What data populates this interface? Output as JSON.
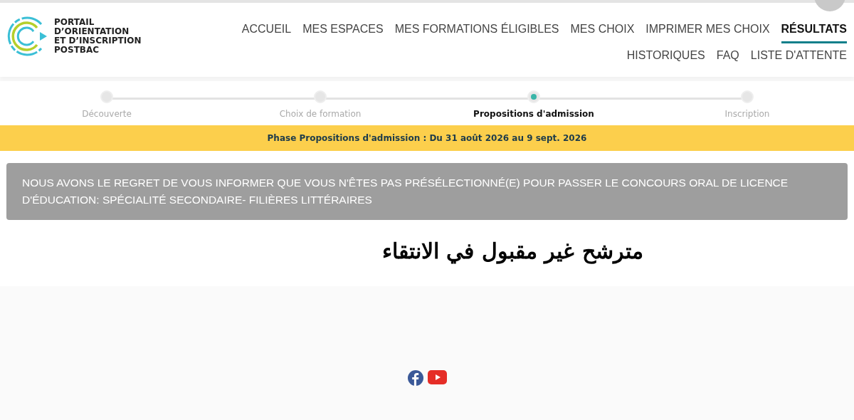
{
  "logo": {
    "lines": [
      "PORTAIL",
      "D’ORIENTATION",
      "ET D’INSCRIPTION",
      "POSTBAC"
    ]
  },
  "nav": [
    {
      "label": "ACCUEIL",
      "selected": false
    },
    {
      "label": "MES ESPACES",
      "selected": false
    },
    {
      "label": "MES FORMATIONS ÉLIGIBLES",
      "selected": false
    },
    {
      "label": "MES CHOIX",
      "selected": false
    },
    {
      "label": "IMPRIMER MES CHOIX",
      "selected": false
    },
    {
      "label": "RÉSULTATS",
      "selected": true
    },
    {
      "label": "HISTORIQUES",
      "selected": false
    },
    {
      "label": "FAQ",
      "selected": false
    },
    {
      "label": "LISTE D'ATTENTE",
      "selected": false
    }
  ],
  "steps": [
    {
      "label": "Découverte",
      "selected": false
    },
    {
      "label": "Choix de formation",
      "selected": false
    },
    {
      "label": "Propositions d'admission",
      "selected": true
    },
    {
      "label": "Inscription",
      "selected": false
    }
  ],
  "phase_banner": "Phase Propositions d'admission : Du 31 août 2026 au 9 sept. 2026",
  "alert": "NOUS AVONS LE REGRET DE VOUS INFORMER QUE VOUS N'ÊTES PAS PRÉSÉLECTIONNÉ(E) POUR PASSER LE CONCOURS ORAL DE LICENCE D'ÉDUCATION: SPÉCIALITÉ SECONDAIRE- FILIÈRES LITTÉRAIRES",
  "result_note": "مترشح غير مقبول في الانتقاء"
}
